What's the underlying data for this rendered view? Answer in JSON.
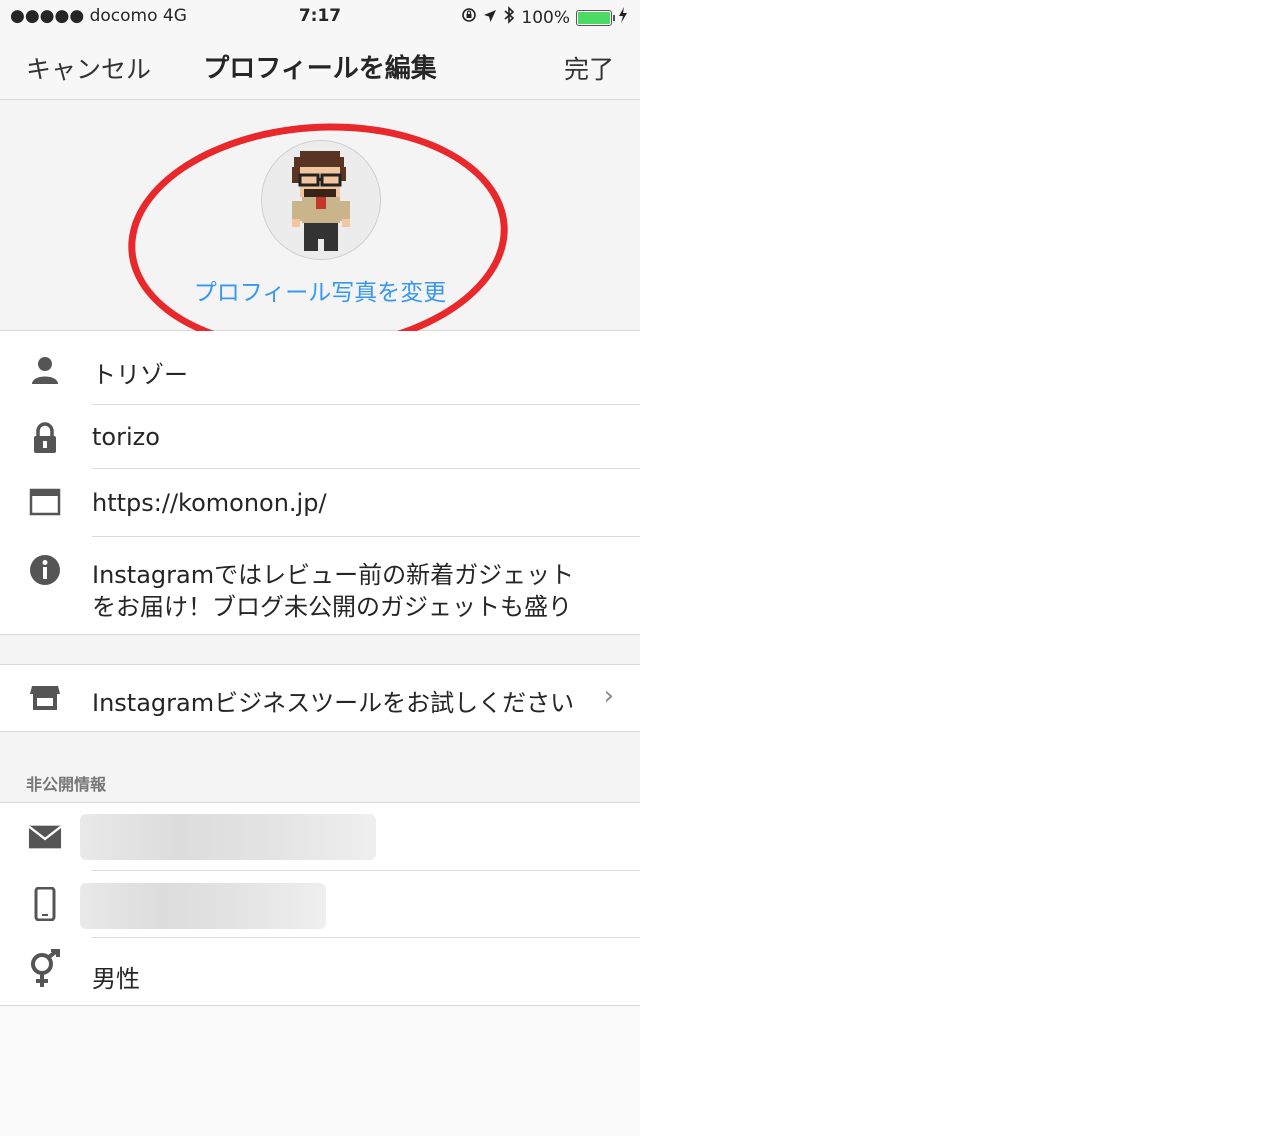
{
  "status_bar": {
    "carrier": "●●●●● docomo   4G",
    "time": "7:17",
    "battery_percent": "100%",
    "battery_level": 1.0,
    "icons": [
      "orientation-lock-icon",
      "location-arrow-icon",
      "bluetooth-icon",
      "charging-bolt-icon"
    ]
  },
  "nav": {
    "cancel": "キャンセル",
    "title": "プロフィールを編集",
    "done": "完了"
  },
  "photo": {
    "change_label": "プロフィール写真を変更",
    "highlight_color": "#e8282b",
    "link_color": "#3897f0"
  },
  "profile": {
    "name": "トリゾー",
    "username": "torizo",
    "website": "https://komonon.jp/",
    "bio_line1": "Instagramではレビュー前の新着ガジェット",
    "bio_line2": "をお届け！ブログ未公開のガジェットも盛り"
  },
  "business": {
    "label": "Instagramビジネスツールをお試しください"
  },
  "private": {
    "header": "非公開情報",
    "gender": "男性"
  }
}
